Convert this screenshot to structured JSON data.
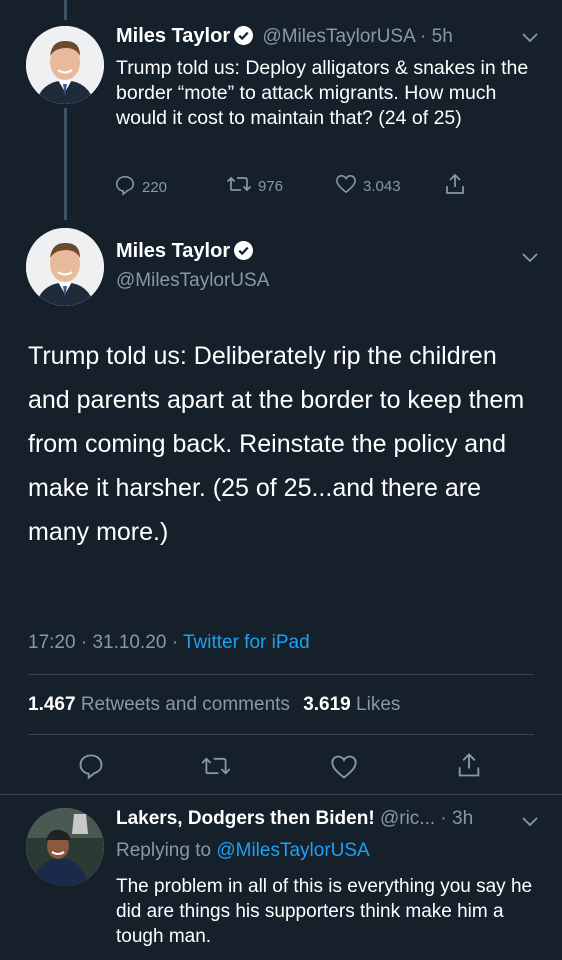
{
  "thread_tweet": {
    "name": "Miles Taylor",
    "handle": "@MilesTaylorUSA",
    "separator": "·",
    "time": "5h",
    "text": "Trump told us: Deploy alligators & snakes in the border “mote” to attack migrants. How much would it cost to maintain that? (24 of 25)",
    "replies": "220",
    "retweets": "976",
    "likes": "3.043"
  },
  "main_tweet": {
    "name": "Miles Taylor",
    "handle": "@MilesTaylorUSA",
    "text": "Trump told us: Deliberately rip the children and parents apart at the border to keep them from coming back. Reinstate the policy and make it harsher. (25 of 25...and there are many more.)",
    "time": "17:20",
    "date": "31.10.20",
    "source": "Twitter for iPad",
    "dot": "·",
    "retweets_count": "1.467",
    "retweets_label": "Retweets and comments",
    "likes_count": "3.619",
    "likes_label": "Likes"
  },
  "reply_tweet": {
    "name": "Lakers, Dodgers then Biden!",
    "handle": "@ric...",
    "separator": "·",
    "time": "3h",
    "replying_label": "Replying to",
    "replying_handle": "@MilesTaylorUSA",
    "text": "The problem in all of this is everything you say he did are things his supporters think make him a tough man."
  },
  "colors": {
    "background": "#15202b",
    "muted": "#8899a6",
    "link": "#1da1f2",
    "divider": "#38444d"
  }
}
